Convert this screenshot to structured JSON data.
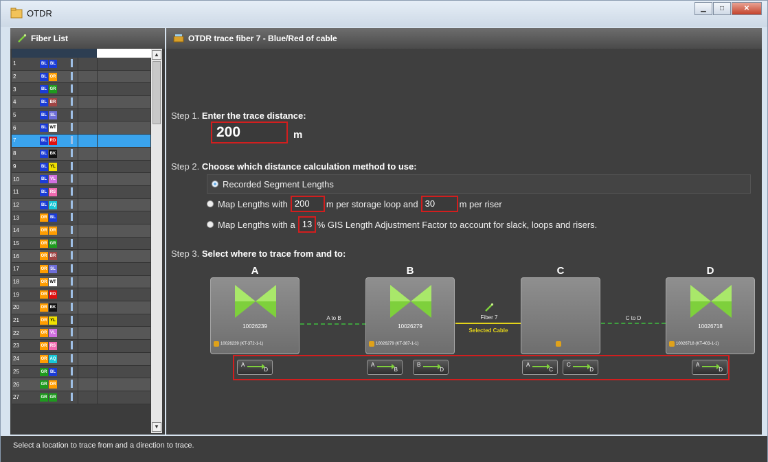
{
  "window": {
    "title": "OTDR"
  },
  "fiber_list": {
    "header": "Fiber List",
    "rows": [
      {
        "num": "1",
        "c1": "BL",
        "c2": "BL",
        "col1": "#1b3cd6",
        "col2": "#1b3cd6"
      },
      {
        "num": "2",
        "c1": "BL",
        "c2": "OR",
        "col1": "#1b3cd6",
        "col2": "#ff9d00"
      },
      {
        "num": "3",
        "c1": "BL",
        "c2": "GR",
        "col1": "#1b3cd6",
        "col2": "#1e9a1e"
      },
      {
        "num": "4",
        "c1": "BL",
        "c2": "BR",
        "col1": "#1b3cd6",
        "col2": "#a04545"
      },
      {
        "num": "5",
        "c1": "BL",
        "c2": "SL",
        "col1": "#1b3cd6",
        "col2": "#6e6ed8"
      },
      {
        "num": "6",
        "c1": "BL",
        "c2": "WT",
        "col1": "#1b3cd6",
        "col2": "#ffffff"
      },
      {
        "num": "7",
        "c1": "BL",
        "c2": "RD",
        "col1": "#1b3cd6",
        "col2": "#e01010"
      },
      {
        "num": "8",
        "c1": "BL",
        "c2": "BK",
        "col1": "#1b3cd6",
        "col2": "#111111"
      },
      {
        "num": "9",
        "c1": "BL",
        "c2": "YL",
        "col1": "#1b3cd6",
        "col2": "#f0e000"
      },
      {
        "num": "10",
        "c1": "BL",
        "c2": "VL",
        "col1": "#1b3cd6",
        "col2": "#d070e0"
      },
      {
        "num": "11",
        "c1": "BL",
        "c2": "RS",
        "col1": "#1b3cd6",
        "col2": "#f06ab0"
      },
      {
        "num": "12",
        "c1": "BL",
        "c2": "AQ",
        "col1": "#1b3cd6",
        "col2": "#18c8d8"
      },
      {
        "num": "13",
        "c1": "OR",
        "c2": "BL",
        "col1": "#ff9d00",
        "col2": "#1b3cd6"
      },
      {
        "num": "14",
        "c1": "OR",
        "c2": "OR",
        "col1": "#ff9d00",
        "col2": "#ff9d00"
      },
      {
        "num": "15",
        "c1": "OR",
        "c2": "GR",
        "col1": "#ff9d00",
        "col2": "#1e9a1e"
      },
      {
        "num": "16",
        "c1": "OR",
        "c2": "BR",
        "col1": "#ff9d00",
        "col2": "#a04545"
      },
      {
        "num": "17",
        "c1": "OR",
        "c2": "SL",
        "col1": "#ff9d00",
        "col2": "#6e6ed8"
      },
      {
        "num": "18",
        "c1": "OR",
        "c2": "WT",
        "col1": "#ff9d00",
        "col2": "#ffffff"
      },
      {
        "num": "19",
        "c1": "OR",
        "c2": "RD",
        "col1": "#ff9d00",
        "col2": "#e01010"
      },
      {
        "num": "20",
        "c1": "OR",
        "c2": "BK",
        "col1": "#ff9d00",
        "col2": "#111111"
      },
      {
        "num": "21",
        "c1": "OR",
        "c2": "YL",
        "col1": "#ff9d00",
        "col2": "#f0e000"
      },
      {
        "num": "22",
        "c1": "OR",
        "c2": "VL",
        "col1": "#ff9d00",
        "col2": "#d070e0"
      },
      {
        "num": "23",
        "c1": "OR",
        "c2": "RS",
        "col1": "#ff9d00",
        "col2": "#f06ab0"
      },
      {
        "num": "24",
        "c1": "OR",
        "c2": "AQ",
        "col1": "#ff9d00",
        "col2": "#18c8d8"
      },
      {
        "num": "25",
        "c1": "GR",
        "c2": "BL",
        "col1": "#1e9a1e",
        "col2": "#1b3cd6"
      },
      {
        "num": "26",
        "c1": "GR",
        "c2": "OR",
        "col1": "#1e9a1e",
        "col2": "#ff9d00"
      },
      {
        "num": "27",
        "c1": "GR",
        "c2": "GR",
        "col1": "#1e9a1e",
        "col2": "#1e9a1e"
      }
    ],
    "selected_row": 7
  },
  "trace_panel": {
    "header": "OTDR trace fiber 7 - Blue/Red of cable",
    "step1": {
      "prefix": "Step 1.",
      "label": "Enter the trace distance:",
      "distance": "200",
      "unit": "m"
    },
    "step2": {
      "prefix": "Step 2.",
      "label": "Choose which distance calculation method to use:",
      "option1": "Recorded Segment Lengths",
      "option2_a": "Map Lengths with",
      "option2_loop": "200",
      "option2_b": "m per storage loop and",
      "option2_riser": "30",
      "option2_c": "m per riser",
      "option3_a": "Map Lengths with a",
      "option3_pct": "13",
      "option3_b": "% GIS Length Adjustment Factor to account for slack, loops and risers."
    },
    "step3": {
      "prefix": "Step 3.",
      "label": "Select where to trace from and to:",
      "nodes": [
        {
          "letter": "A",
          "id": "10026239",
          "sub": "10026239 (KT-372-1-1)"
        },
        {
          "letter": "B",
          "id": "10026279",
          "sub": "10026279 (KT-387-1-1)"
        },
        {
          "letter": "C",
          "id": "",
          "sub": ""
        },
        {
          "letter": "D",
          "id": "10026718",
          "sub": "10026718 (KT-403-1-1)"
        }
      ],
      "links": {
        "ab": "A to B",
        "bc_1": "Fiber 7",
        "bc_2": "Selected Cable",
        "cd": "C to D"
      },
      "trace_buttons": [
        {
          "from": "A",
          "to": "D"
        },
        {
          "from": "A",
          "to": "B"
        },
        {
          "from": "B",
          "to": "D"
        },
        {
          "from": "A",
          "to": "C"
        },
        {
          "from": "C",
          "to": "D"
        },
        {
          "from": "A",
          "to": "D"
        }
      ]
    }
  },
  "status": "Select a location to trace from and a direction to trace.",
  "colors": {
    "highlight": "#d21e1e",
    "accent_green": "#7ed03c",
    "selected_row": "#3aa4ee"
  }
}
